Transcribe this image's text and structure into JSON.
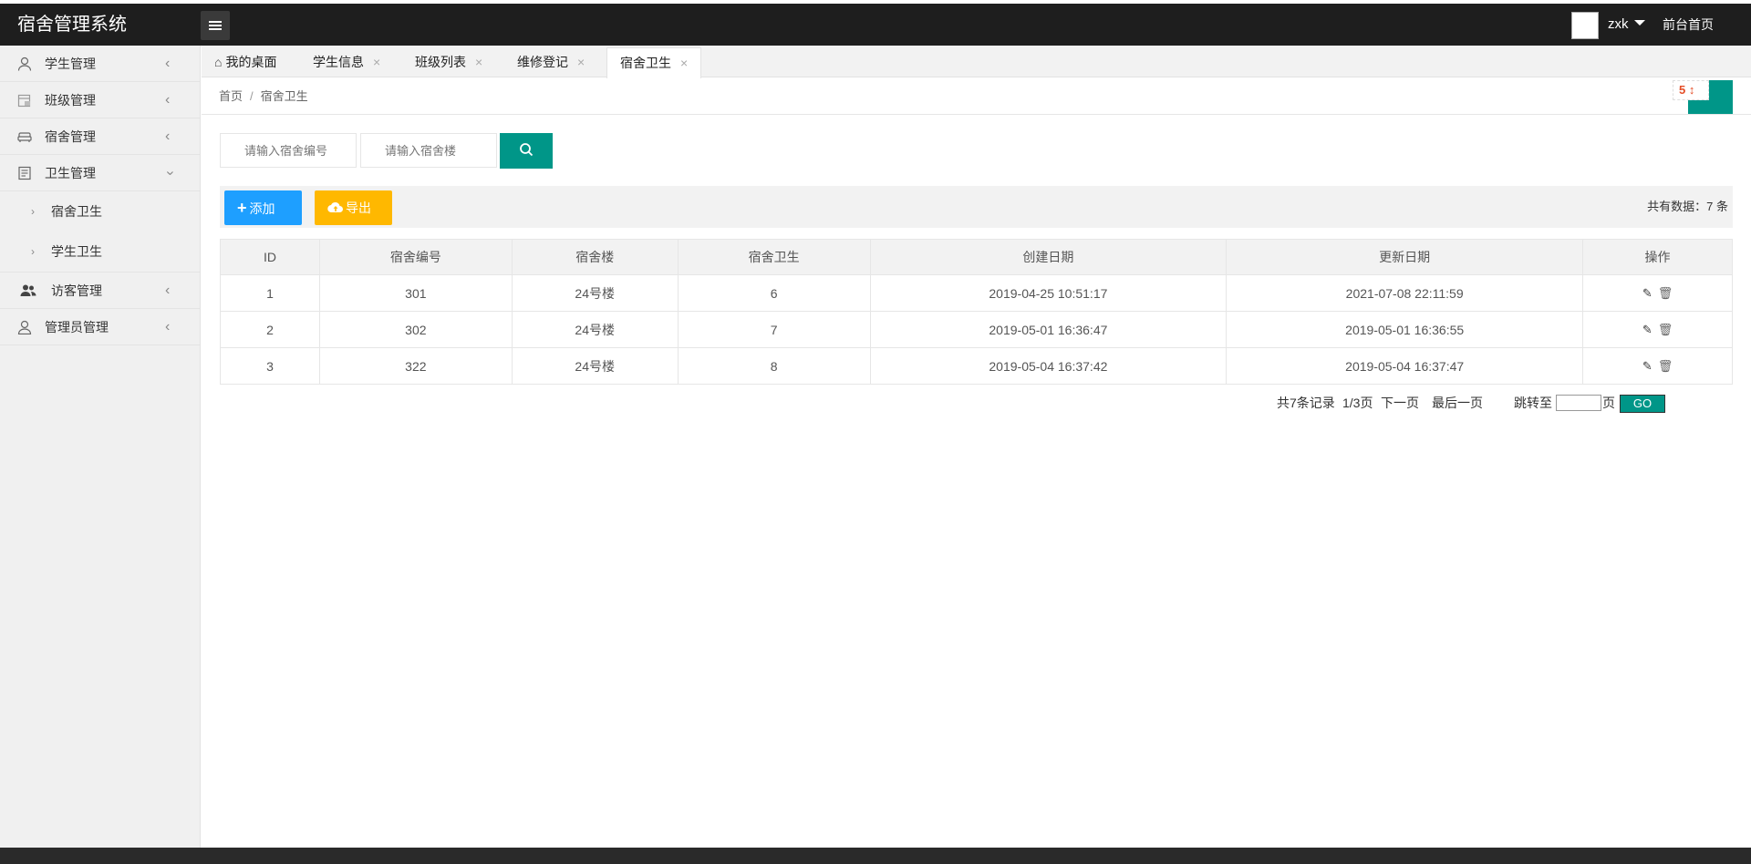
{
  "header": {
    "app_title": "宿舍管理系统",
    "user_name": "zxk",
    "front_link": "前台首页"
  },
  "sidebar": {
    "items": [
      {
        "label": "学生管理"
      },
      {
        "label": "班级管理"
      },
      {
        "label": "宿舍管理"
      },
      {
        "label": "卫生管理",
        "sub": [
          "宿舍卫生",
          "学生卫生"
        ]
      },
      {
        "label": "访客管理"
      },
      {
        "label": "管理员管理"
      }
    ]
  },
  "tabs": [
    {
      "label": "我的桌面"
    },
    {
      "label": "学生信息"
    },
    {
      "label": "班级列表"
    },
    {
      "label": "维修登记"
    },
    {
      "label": "宿舍卫生"
    }
  ],
  "breadcrumb": {
    "home": "首页",
    "sep": "/",
    "current": "宿舍卫生"
  },
  "search": {
    "room_placeholder": "请输入宿舍编号",
    "building_placeholder": "请输入宿舍楼"
  },
  "toolbar": {
    "add_label": "添加",
    "export_label": "导出",
    "total_text": "共有数据：7 条"
  },
  "table": {
    "headers": [
      "ID",
      "宿舍编号",
      "宿舍楼",
      "宿舍卫生",
      "创建日期",
      "更新日期",
      "操作"
    ],
    "rows": [
      [
        "1",
        "301",
        "24号楼",
        "6",
        "2019-04-25 10:51:17",
        "2021-07-08 22:11:59"
      ],
      [
        "2",
        "302",
        "24号楼",
        "7",
        "2019-05-01 16:36:47",
        "2019-05-01 16:36:55"
      ],
      [
        "3",
        "322",
        "24号楼",
        "8",
        "2019-05-04 16:37:42",
        "2019-05-04 16:37:47"
      ]
    ]
  },
  "pager": {
    "records": "共7条记录",
    "page": "1/3页",
    "next": "下一页",
    "last": "最后一页",
    "jump": "跳转至",
    "page_unit": "页",
    "go": "GO"
  },
  "icons": {
    "menu": "menu-bars-icon",
    "search": "search-icon",
    "home": "home-icon",
    "edit": "pencil-icon",
    "delete": "trash-icon"
  },
  "colors": {
    "header_bg": "#1e1e1e",
    "primary": "#009688",
    "add_button": "#1e9fff",
    "export_button": "#ffb800"
  }
}
